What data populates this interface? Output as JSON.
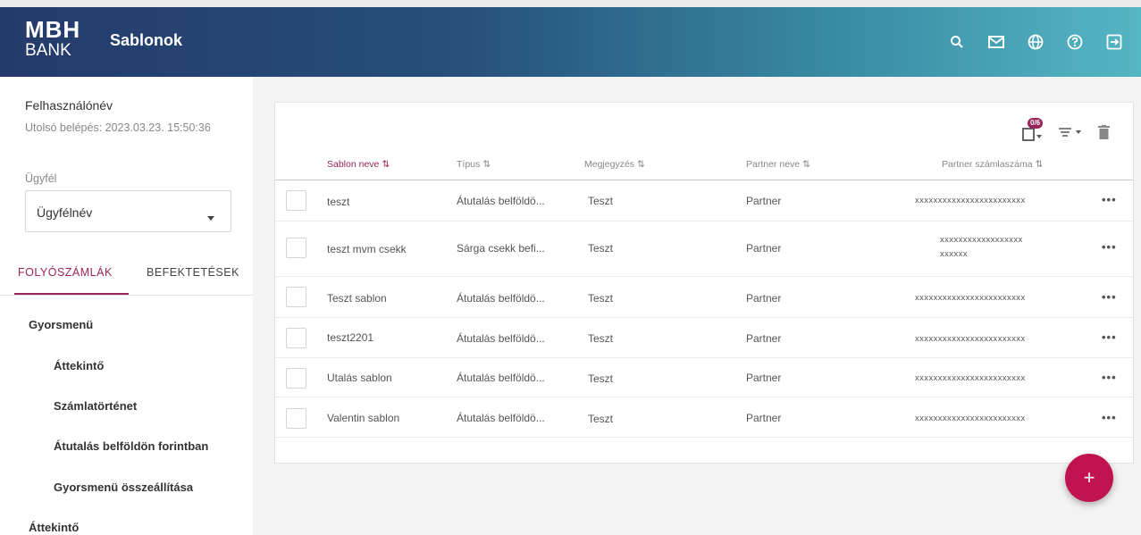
{
  "header": {
    "logo_line1": "MBH",
    "logo_line2": "BANK",
    "title": "Sablonok",
    "icons": [
      "search-icon",
      "mail-icon",
      "globe-icon",
      "help-icon",
      "logout-icon"
    ]
  },
  "sidebar": {
    "user_name": "Felhasználónév",
    "last_login": "Utolsó belépés: 2023.03.23. 15:50:36",
    "client_label": "Ügyfél",
    "client_value": "Ügyfélnév",
    "tabs": [
      "FOLYÓSZÁMLÁK",
      "BEFEKTETÉSEK"
    ],
    "menu": [
      {
        "label": "Gyorsmenü"
      },
      {
        "label": "Áttekintő"
      },
      {
        "label": "Számlatörténet"
      },
      {
        "label": "Átutalás belföldön forintban"
      },
      {
        "label": "Gyorsmenü összeállítása"
      },
      {
        "label": "Áttekintő"
      }
    ]
  },
  "table": {
    "selection_badge": "0/6",
    "columns": [
      "Sablon neve",
      "Típus",
      "Megjegyzés",
      "Partner neve",
      "Partner számlaszáma"
    ],
    "rows": [
      {
        "name": "teszt",
        "type": "Átutalás belföldö...",
        "note": "Teszt",
        "partner": "Partner",
        "account": "xxxxxxxxxxxxxxxxxxxxxxxx",
        "account2": ""
      },
      {
        "name": "teszt mvm csekk",
        "type": "Sárga csekk befi...",
        "note": "Teszt",
        "partner": "Partner",
        "account": "xxxxxxxxxxxxxxxxxx",
        "account2": "xxxxxx"
      },
      {
        "name": "Teszt sablon",
        "type": "Átutalás belföldö...",
        "note": "Teszt",
        "partner": "Partner",
        "account": "xxxxxxxxxxxxxxxxxxxxxxxx",
        "account2": ""
      },
      {
        "name": "teszt2201",
        "type": "Átutalás belföldö...",
        "note": "Teszt",
        "partner": "Partner",
        "account": "xxxxxxxxxxxxxxxxxxxxxxxx",
        "account2": ""
      },
      {
        "name": "Utalás sablon",
        "type": "Átutalás belföldö...",
        "note": "Teszt",
        "partner": "Partner",
        "account": "xxxxxxxxxxxxxxxxxxxxxxxx",
        "account2": ""
      },
      {
        "name": "Valentin sablon",
        "type": "Átutalás belföldö...",
        "note": "Teszt",
        "partner": "Partner",
        "account": "xxxxxxxxxxxxxxxxxxxxxxxx",
        "account2": ""
      }
    ],
    "row_action": "•••"
  },
  "fab_label": "+",
  "colors": {
    "accent": "#9a2459",
    "fab": "#c0134f",
    "header_start": "#243a6a",
    "header_end": "#55b6c4"
  }
}
